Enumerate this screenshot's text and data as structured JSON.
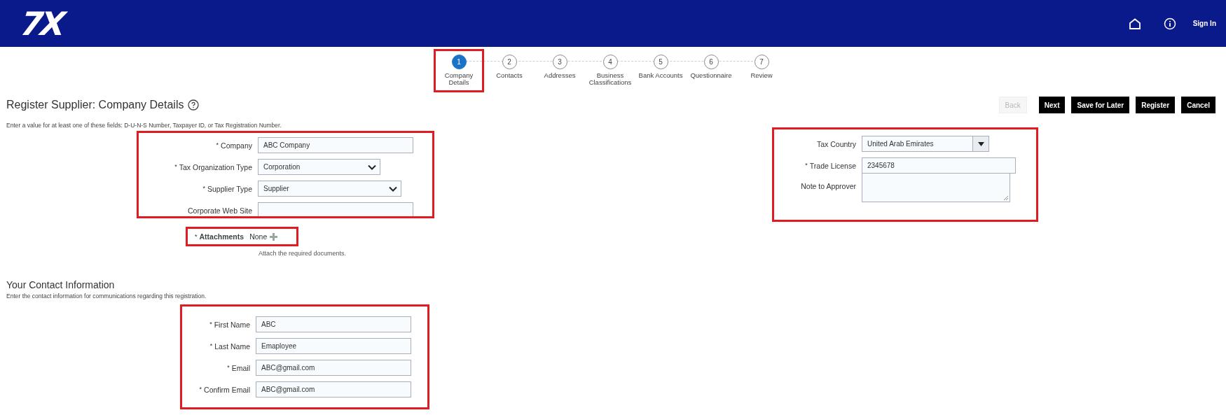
{
  "header": {
    "logo": "7X",
    "sign_in": "Sign In"
  },
  "steps": [
    {
      "number": "1",
      "label": "Company Details",
      "selected": true,
      "highlighted": true
    },
    {
      "number": "2",
      "label": "Contacts",
      "selected": false,
      "highlighted": false
    },
    {
      "number": "3",
      "label": "Addresses",
      "selected": false,
      "highlighted": false
    },
    {
      "number": "4",
      "label": "Business Classifications",
      "selected": false,
      "highlighted": false
    },
    {
      "number": "5",
      "label": "Bank Accounts",
      "selected": false,
      "highlighted": false
    },
    {
      "number": "6",
      "label": "Questionnaire",
      "selected": false,
      "highlighted": false
    },
    {
      "number": "7",
      "label": "Review",
      "selected": false,
      "highlighted": false
    }
  ],
  "page_title": "Register Supplier: Company Details",
  "buttons": [
    {
      "label": "Back",
      "disabled": true
    },
    {
      "label": "Next",
      "disabled": false
    },
    {
      "label": "Save for Later",
      "disabled": false
    },
    {
      "label": "Register",
      "disabled": false
    },
    {
      "label": "Cancel",
      "disabled": false
    }
  ],
  "instruction": "Enter a value for at least one of these fields: D-U-N-S Number, Taxpayer ID, or Tax Registration Number.",
  "company_fields": {
    "highlighted": true,
    "fields": [
      {
        "kind": "text",
        "required_mark": "*",
        "label": "Company",
        "value": "ABC Company"
      },
      {
        "kind": "select",
        "required_mark": "*",
        "label": "Tax Organization Type",
        "value": "Corporation"
      },
      {
        "kind": "select",
        "required_mark": "*",
        "label": "Supplier Type",
        "value": "Supplier"
      },
      {
        "kind": "text",
        "label": "Corporate Web Site"
      }
    ]
  },
  "attachments": {
    "highlighted": true,
    "required_mark": "*",
    "label": "Attachments",
    "value": "None",
    "hint": "Attach the required documents."
  },
  "tax_fields": {
    "highlighted": true,
    "fields": [
      {
        "kind": "combo",
        "label": "Tax Country",
        "value": "United Arab Emirates"
      },
      {
        "kind": "text",
        "required_mark": "*",
        "label": "Trade License",
        "value": "2345678"
      },
      {
        "kind": "textarea",
        "label": "Note to Approver"
      }
    ]
  },
  "contact": {
    "title": "Your Contact Information",
    "subtitle": "Enter the contact information for communications regarding this registration.",
    "highlighted": true,
    "fields": [
      {
        "kind": "text",
        "required_mark": "*",
        "label": "First Name",
        "value": "ABC"
      },
      {
        "kind": "text",
        "required_mark": "*",
        "label": "Last Name",
        "value": "Emaployee"
      },
      {
        "kind": "text",
        "required_mark": "*",
        "label": "Email",
        "value": "ABC@gmail.com"
      },
      {
        "kind": "text",
        "required_mark": "*",
        "label": "Confirm Email",
        "value": "ABC@gmail.com"
      }
    ]
  }
}
